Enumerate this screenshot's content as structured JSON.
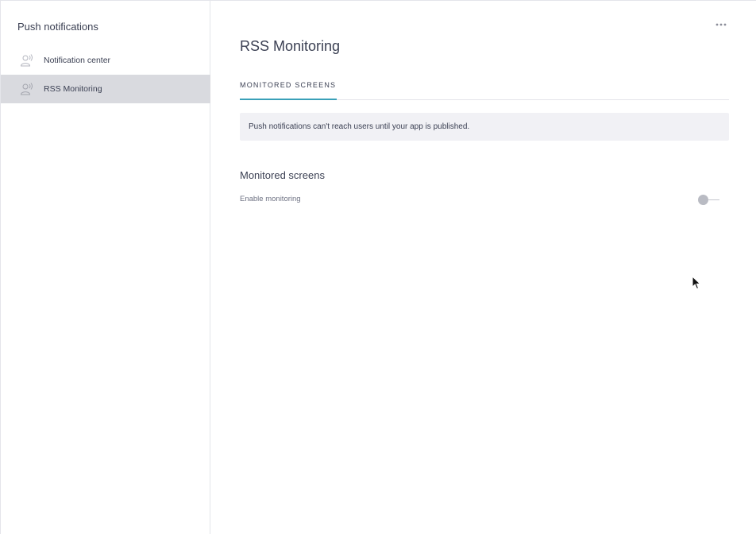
{
  "sidebar": {
    "title": "Push notifications",
    "items": [
      {
        "label": "Notification center",
        "icon": "broadcast-user-icon",
        "active": false
      },
      {
        "label": "RSS Monitoring",
        "icon": "broadcast-user-icon",
        "active": true
      }
    ]
  },
  "main": {
    "more_icon": "more-horizontal-icon",
    "title": "RSS Monitoring",
    "tabs": [
      {
        "label": "MONITORED SCREENS",
        "active": true
      }
    ],
    "notice": "Push notifications can't reach users until your app is published.",
    "section": {
      "title": "Monitored screens",
      "settings": [
        {
          "label": "Enable monitoring",
          "enabled": false
        }
      ]
    }
  },
  "colors": {
    "accent": "#3aa0b8",
    "active_item_bg": "#d9dadf",
    "notice_bg": "#f1f1f5",
    "text": "#3a3f52"
  }
}
